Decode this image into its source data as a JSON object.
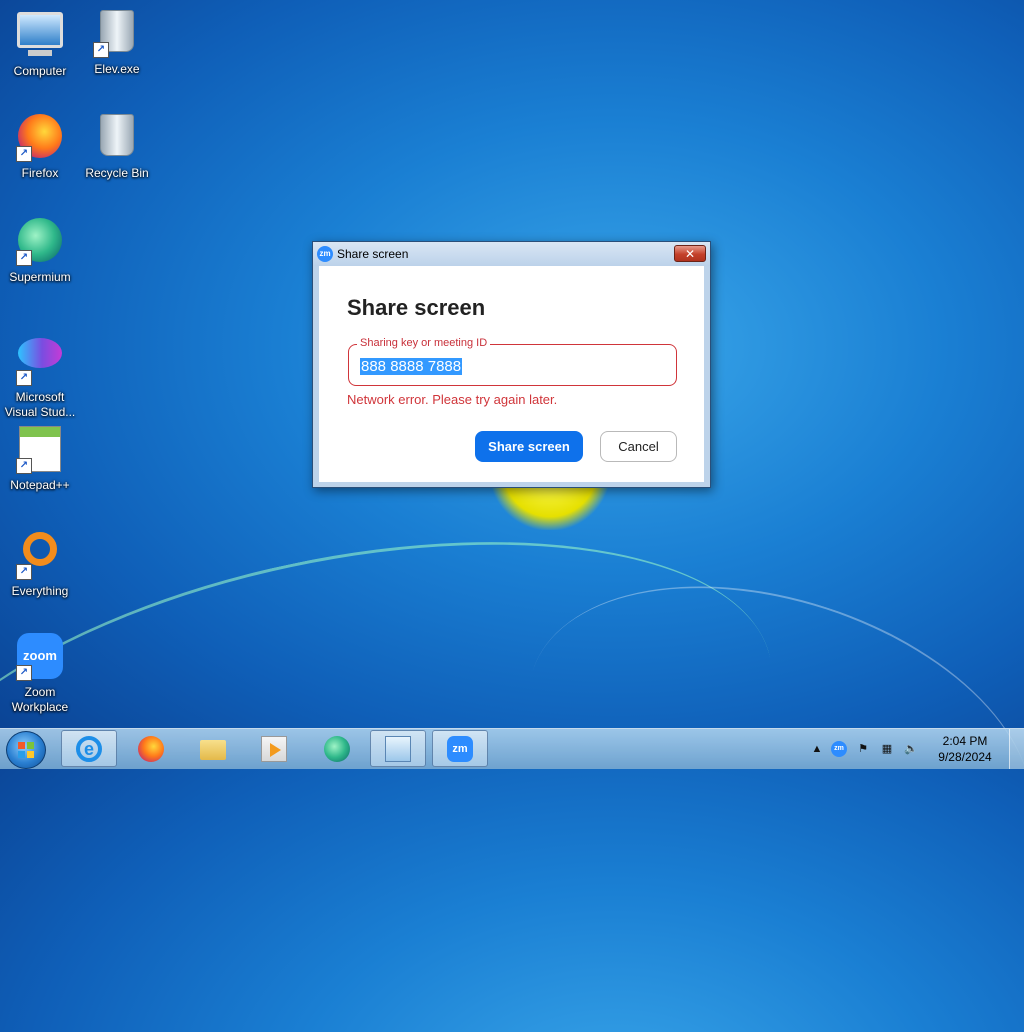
{
  "desktop": {
    "icons": [
      {
        "label": "Computer"
      },
      {
        "label": "Elev.exe"
      },
      {
        "label": "Firefox"
      },
      {
        "label": "Recycle Bin"
      },
      {
        "label": "Supermium"
      },
      {
        "label": "Microsoft Visual Stud..."
      },
      {
        "label": "Notepad++"
      },
      {
        "label": "Everything"
      },
      {
        "label": "Zoom Workplace"
      }
    ],
    "zoom_icon_text": "zoom"
  },
  "dialog": {
    "window_title": "Share screen",
    "title_icon_text": "zm",
    "close_glyph": "✕",
    "heading": "Share screen",
    "field_label": "Sharing key or meeting ID",
    "field_value": "888 8888 7888",
    "error_message": "Network error. Please try again later.",
    "primary_button": "Share screen",
    "cancel_button": "Cancel",
    "error_color": "#d0353a",
    "primary_color": "#0e71eb"
  },
  "taskbar": {
    "apps": [
      {
        "name": "Internet Explorer",
        "glyph": "e"
      },
      {
        "name": "Firefox"
      },
      {
        "name": "Windows Explorer"
      },
      {
        "name": "Windows Media Player"
      },
      {
        "name": "Supermium"
      },
      {
        "name": "Remote Desktop"
      },
      {
        "name": "Zoom",
        "glyph": "zm"
      }
    ],
    "tray": {
      "chevron": "▲",
      "zoom_text": "zm",
      "flag": "⚑",
      "network": "▦",
      "volume": "🔈"
    },
    "clock": {
      "time": "2:04 PM",
      "date": "9/28/2024"
    }
  }
}
